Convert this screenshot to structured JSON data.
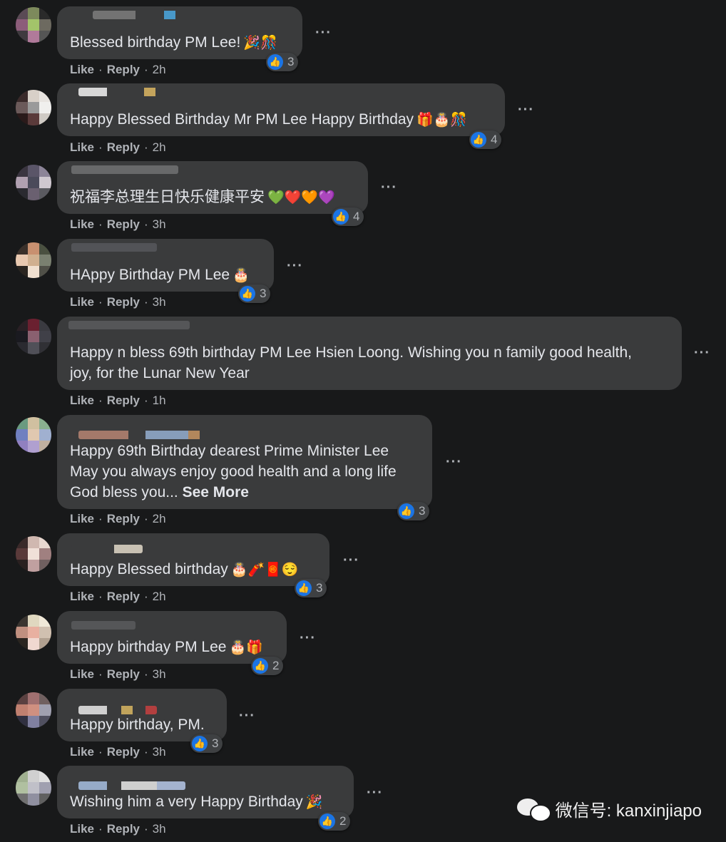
{
  "actions": {
    "like": "Like",
    "reply": "Reply",
    "sep": "·",
    "more": "···"
  },
  "see_more": "See More",
  "comments": [
    {
      "text": "Blessed birthday PM Lee!",
      "emoji": "🎉🎊",
      "reactions": "3",
      "time": "2h"
    },
    {
      "text": "Happy Blessed Birthday Mr PM Lee Happy Birthday",
      "emoji": "🎁🎂🎊",
      "reactions": "4",
      "time": "2h"
    },
    {
      "text": "祝福李总理生日快乐健康平安",
      "emoji": "💚❤️🧡💜",
      "reactions": "4",
      "time": "3h"
    },
    {
      "text": "HAppy Birthday PM Lee",
      "emoji": "🎂",
      "reactions": "3",
      "time": "3h"
    },
    {
      "text": "Happy n bless 69th birthday PM Lee Hsien Loong. Wishing you n family good health,\njoy, for the Lunar New Year",
      "emoji": "",
      "reactions": "",
      "time": "1h"
    },
    {
      "text": "Happy 69th Birthday dearest Prime Minister Lee\nMay you always enjoy good health and a long life\nGod bless you... ",
      "emoji": "",
      "reactions": "3",
      "time": "2h"
    },
    {
      "text": "Happy Blessed birthday",
      "emoji": "🎂🧨🧧😌",
      "reactions": "3",
      "time": "2h"
    },
    {
      "text": "Happy birthday PM Lee",
      "emoji": "🎂🎁",
      "reactions": "2",
      "time": "3h"
    },
    {
      "text": "Happy birthday, PM.",
      "emoji": "",
      "reactions": "3",
      "time": "3h"
    },
    {
      "text": "Wishing him a very Happy Birthday",
      "emoji": "🎉",
      "reactions": "2",
      "time": "3h"
    }
  ],
  "watermark": {
    "label": "微信号: kanxinjiapo"
  },
  "colors": {
    "background": "#18191a",
    "bubble": "#3a3b3c",
    "like_blue": "#1b74e4",
    "muted": "#b0b3b8"
  }
}
